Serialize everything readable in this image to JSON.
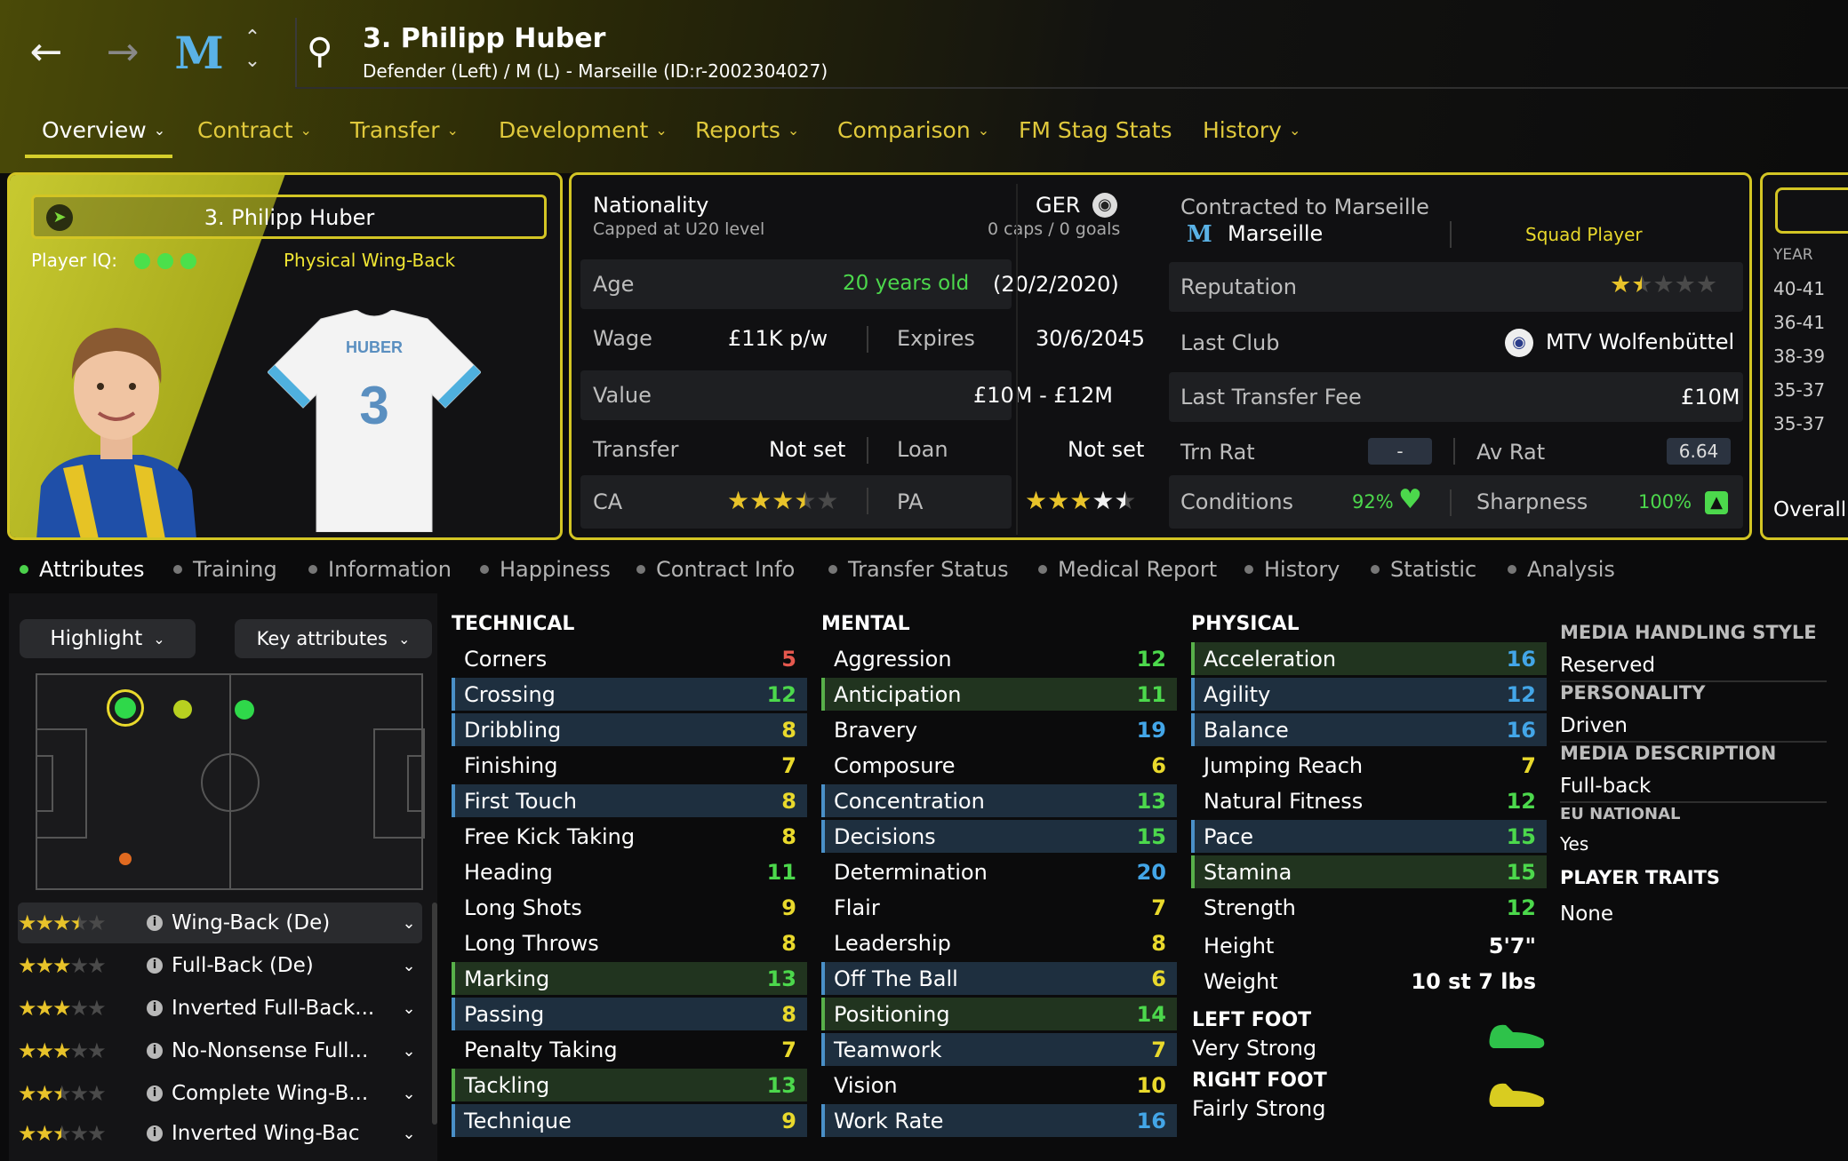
{
  "header": {
    "title": "3. Philipp Huber",
    "subtitle": "Defender (Left) / M (L) - Marseille (ID:r-2002304027)"
  },
  "main_tabs": [
    {
      "label": "Overview"
    },
    {
      "label": "Contract"
    },
    {
      "label": "Transfer"
    },
    {
      "label": "Development"
    },
    {
      "label": "Reports"
    },
    {
      "label": "Comparison"
    },
    {
      "label": "FM Stag Stats"
    },
    {
      "label": "History"
    }
  ],
  "player_card": {
    "name": "3. Philipp Huber",
    "iq_label": "Player IQ:",
    "iq_level": 3,
    "role": "Physical Wing-Back",
    "shirt_name": "HUBER",
    "shirt_number": "3"
  },
  "info": {
    "nationality_label": "Nationality",
    "nationality_value": "GER",
    "capped": "Capped at U20 level",
    "caps": "0 caps / 0 goals",
    "age_label": "Age",
    "age_value": "20 years old",
    "dob": "(20/2/2020)",
    "wage_label": "Wage",
    "wage_value": "£11K p/w",
    "expires_label": "Expires",
    "expires_value": "30/6/2045",
    "value_label": "Value",
    "value_value": "£10M - £12M",
    "transfer_label": "Transfer",
    "transfer_value": "Not set",
    "loan_label": "Loan",
    "loan_value": "Not set",
    "ca_label": "CA",
    "ca_stars": 3.5,
    "pa_label": "PA",
    "pa_stars": 4.5,
    "contracted_label": "Contracted to Marseille",
    "club": "Marseille",
    "squad_status": "Squad Player",
    "reputation_label": "Reputation",
    "reputation_stars": 1.5,
    "last_club_label": "Last Club",
    "last_club_value": "MTV Wolfenbüttel",
    "last_fee_label": "Last Transfer Fee",
    "last_fee_value": "£10M",
    "trn_rat_label": "Trn Rat",
    "trn_rat_value": "-",
    "av_rat_label": "Av Rat",
    "av_rat_value": "6.64",
    "conditions_label": "Conditions",
    "conditions_value": "92%",
    "sharpness_label": "Sharpness",
    "sharpness_value": "100%"
  },
  "history_panel": {
    "year_label": "YEAR",
    "years": [
      "40-41",
      "36-41",
      "38-39",
      "35-37",
      "35-37"
    ],
    "overall_label": "Overall"
  },
  "sub_tabs": [
    "Attributes",
    "Training",
    "Information",
    "Happiness",
    "Contract Info",
    "Transfer Status",
    "Medical Report",
    "History",
    "Statistic",
    "Analysis"
  ],
  "left_panel": {
    "highlight_label": "Highlight",
    "key_attributes_label": "Key attributes",
    "roles": [
      {
        "stars": 3.5,
        "name": "Wing-Back (De)"
      },
      {
        "stars": 3,
        "name": "Full-Back (De)"
      },
      {
        "stars": 3,
        "name": "Inverted Full-Back..."
      },
      {
        "stars": 3,
        "name": "No-Nonsense Full..."
      },
      {
        "stars": 2.5,
        "name": "Complete Wing-B..."
      },
      {
        "stars": 2.5,
        "name": "Inverted Wing-Bac"
      }
    ]
  },
  "technical": {
    "heading": "TECHNICAL",
    "items": [
      {
        "name": "Corners",
        "value": "5",
        "color": "red",
        "hl": ""
      },
      {
        "name": "Crossing",
        "value": "12",
        "color": "green",
        "hl": "blue"
      },
      {
        "name": "Dribbling",
        "value": "8",
        "color": "yellow",
        "hl": "blue"
      },
      {
        "name": "Finishing",
        "value": "7",
        "color": "yellow",
        "hl": ""
      },
      {
        "name": "First Touch",
        "value": "8",
        "color": "yellow",
        "hl": "blue"
      },
      {
        "name": "Free Kick Taking",
        "value": "8",
        "color": "yellow",
        "hl": ""
      },
      {
        "name": "Heading",
        "value": "11",
        "color": "green",
        "hl": ""
      },
      {
        "name": "Long Shots",
        "value": "9",
        "color": "yellow",
        "hl": ""
      },
      {
        "name": "Long Throws",
        "value": "8",
        "color": "yellow",
        "hl": ""
      },
      {
        "name": "Marking",
        "value": "13",
        "color": "green",
        "hl": "green"
      },
      {
        "name": "Passing",
        "value": "8",
        "color": "yellow",
        "hl": "blue"
      },
      {
        "name": "Penalty Taking",
        "value": "7",
        "color": "yellow",
        "hl": ""
      },
      {
        "name": "Tackling",
        "value": "13",
        "color": "green",
        "hl": "green"
      },
      {
        "name": "Technique",
        "value": "9",
        "color": "yellow",
        "hl": "blue"
      }
    ]
  },
  "mental": {
    "heading": "MENTAL",
    "items": [
      {
        "name": "Aggression",
        "value": "12",
        "color": "green",
        "hl": ""
      },
      {
        "name": "Anticipation",
        "value": "11",
        "color": "green",
        "hl": "green"
      },
      {
        "name": "Bravery",
        "value": "19",
        "color": "blue",
        "hl": ""
      },
      {
        "name": "Composure",
        "value": "6",
        "color": "yellow",
        "hl": ""
      },
      {
        "name": "Concentration",
        "value": "13",
        "color": "green",
        "hl": "blue"
      },
      {
        "name": "Decisions",
        "value": "15",
        "color": "green",
        "hl": "blue"
      },
      {
        "name": "Determination",
        "value": "20",
        "color": "blue",
        "hl": ""
      },
      {
        "name": "Flair",
        "value": "7",
        "color": "yellow",
        "hl": ""
      },
      {
        "name": "Leadership",
        "value": "8",
        "color": "yellow",
        "hl": ""
      },
      {
        "name": "Off The Ball",
        "value": "6",
        "color": "yellow",
        "hl": "blue"
      },
      {
        "name": "Positioning",
        "value": "14",
        "color": "green",
        "hl": "green"
      },
      {
        "name": "Teamwork",
        "value": "7",
        "color": "yellow",
        "hl": "blue"
      },
      {
        "name": "Vision",
        "value": "10",
        "color": "yellow",
        "hl": ""
      },
      {
        "name": "Work Rate",
        "value": "16",
        "color": "blue",
        "hl": "blue"
      }
    ]
  },
  "physical": {
    "heading": "PHYSICAL",
    "items": [
      {
        "name": "Acceleration",
        "value": "16",
        "color": "blue",
        "hl": "green"
      },
      {
        "name": "Agility",
        "value": "12",
        "color": "blue",
        "hl": "blue"
      },
      {
        "name": "Balance",
        "value": "16",
        "color": "blue",
        "hl": "blue"
      },
      {
        "name": "Jumping Reach",
        "value": "7",
        "color": "yellow",
        "hl": ""
      },
      {
        "name": "Natural Fitness",
        "value": "12",
        "color": "green",
        "hl": ""
      },
      {
        "name": "Pace",
        "value": "15",
        "color": "green",
        "hl": "blue"
      },
      {
        "name": "Stamina",
        "value": "15",
        "color": "green",
        "hl": "green"
      },
      {
        "name": "Strength",
        "value": "12",
        "color": "green",
        "hl": ""
      }
    ],
    "height_label": "Height",
    "height_value": "5'7\"",
    "weight_label": "Weight",
    "weight_value": "10 st 7 lbs",
    "left_foot_label": "LEFT FOOT",
    "left_foot_value": "Very Strong",
    "right_foot_label": "RIGHT FOOT",
    "right_foot_value": "Fairly Strong"
  },
  "right_panel": {
    "media_style_label": "MEDIA HANDLING STYLE",
    "media_style_value": "Reserved",
    "personality_label": "PERSONALITY",
    "personality_value": "Driven",
    "media_desc_label": "MEDIA DESCRIPTION",
    "media_desc_value": "Full-back",
    "eu_label": "EU NATIONAL",
    "eu_value": "Yes",
    "traits_label": "PLAYER TRAITS",
    "traits_value": "None"
  },
  "colors": {
    "accent": "#d3c524",
    "red": "#e5584e",
    "yellow": "#e9d92c",
    "green": "#4cd84c",
    "blue": "#43a6e8"
  }
}
